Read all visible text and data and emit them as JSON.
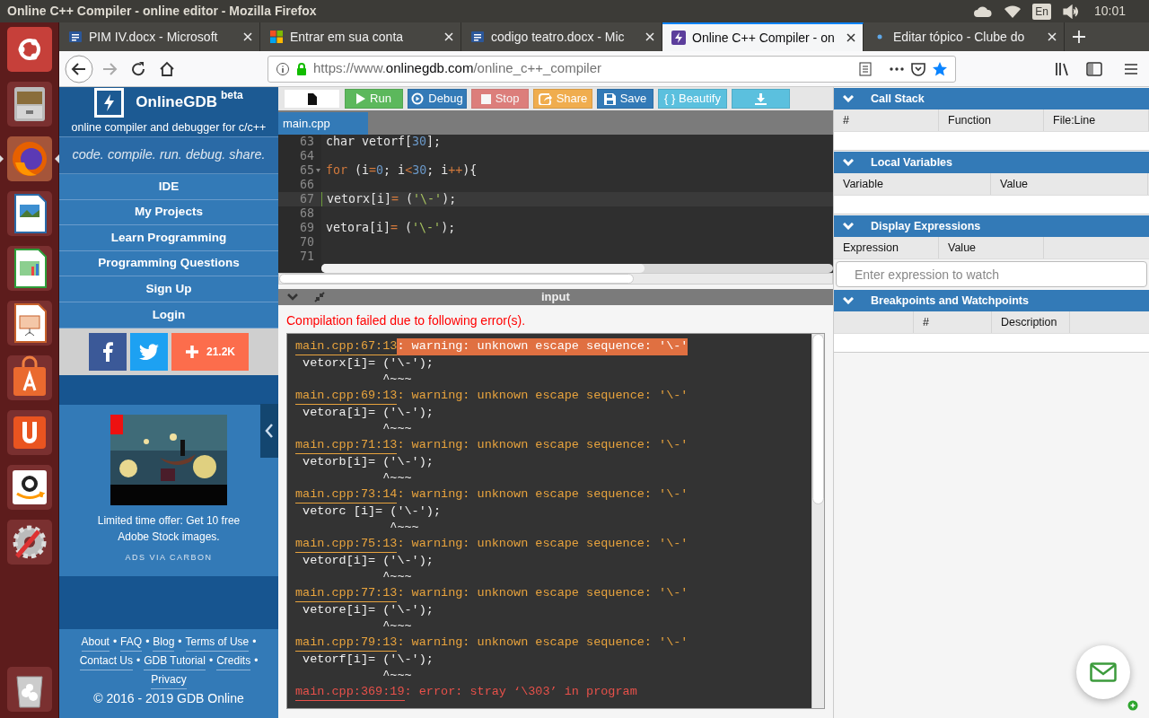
{
  "system_bar": {
    "window_title": "Online C++ Compiler - online editor - Mozilla Firefox",
    "keyboard_layout": "En",
    "clock": "10:01"
  },
  "launcher": {
    "items": [
      {
        "kind": "ubuntu",
        "running": false
      },
      {
        "kind": "files",
        "running": false
      },
      {
        "kind": "firefox",
        "running": true
      },
      {
        "kind": "draw",
        "running": false
      },
      {
        "kind": "calc",
        "running": false
      },
      {
        "kind": "impress",
        "running": false
      },
      {
        "kind": "store",
        "running": false
      },
      {
        "kind": "ubuntu-one",
        "running": false
      },
      {
        "kind": "amazon",
        "running": false
      },
      {
        "kind": "settings",
        "running": false
      },
      {
        "kind": "trash",
        "running": false
      }
    ]
  },
  "browser": {
    "tabs": [
      {
        "title": "PIM IV.docx - Microsoft",
        "kind": "word",
        "selected": false
      },
      {
        "title": "Entrar em sua conta",
        "kind": "microsoft",
        "selected": false
      },
      {
        "title": "codigo teatro.docx - Mic",
        "kind": "word",
        "selected": false
      },
      {
        "title": "Online C++ Compiler - on",
        "kind": "gdb",
        "selected": true
      },
      {
        "title": "Editar tópico - Clube do",
        "kind": "dot",
        "selected": false
      }
    ],
    "url": {
      "scheme": "https://www.",
      "domain": "onlinegdb.com",
      "path": "/online_c++_compiler"
    }
  },
  "sidebar": {
    "brand": "OnlineGDB",
    "badge": "beta",
    "tagline": "online compiler and debugger for c/c++",
    "motto": "code. compile. run. debug. share.",
    "nav": [
      "IDE",
      "My Projects",
      "Learn Programming",
      "Programming Questions",
      "Sign Up",
      "Login"
    ],
    "share_count": "21.2K",
    "ad": {
      "text": "Limited time offer: Get 10 free Adobe Stock images.",
      "via": "ADS VIA CARBON"
    },
    "footer_links": [
      "About",
      "FAQ",
      "Blog",
      "Terms of Use",
      "Contact Us",
      "GDB Tutorial",
      "Credits",
      "Privacy"
    ],
    "separator": "•",
    "copyright": "© 2016 - 2019 GDB Online"
  },
  "toolbar": [
    {
      "kind": "new-file",
      "disabled": false
    },
    {
      "kind": "run",
      "label": "Run",
      "disabled": false
    },
    {
      "kind": "debug",
      "label": "Debug",
      "disabled": false
    },
    {
      "kind": "stop",
      "label": "Stop",
      "disabled": true
    },
    {
      "kind": "share",
      "label": "Share",
      "disabled": false
    },
    {
      "kind": "save",
      "label": "Save",
      "disabled": false
    },
    {
      "kind": "beautify",
      "label": "{ } Beautify",
      "disabled": false
    },
    {
      "kind": "download",
      "disabled": false
    }
  ],
  "editor": {
    "file_tab": "main.cpp",
    "lines": [
      {
        "number": "63",
        "current": false,
        "foldable": false,
        "tokens": [
          {
            "kind": "plain",
            "text": "char vetorf["
          },
          {
            "kind": "number",
            "text": "30"
          },
          {
            "kind": "plain",
            "text": "];"
          }
        ]
      },
      {
        "number": "64",
        "current": false,
        "foldable": false
      },
      {
        "number": "65",
        "current": false,
        "foldable": true,
        "tokens": [
          {
            "kind": "keyword",
            "text": "for"
          },
          {
            "kind": "plain",
            "text": " (i"
          },
          {
            "kind": "operator",
            "text": "="
          },
          {
            "kind": "number",
            "text": "0"
          },
          {
            "kind": "plain",
            "text": "; i"
          },
          {
            "kind": "operator",
            "text": "<"
          },
          {
            "kind": "number",
            "text": "30"
          },
          {
            "kind": "plain",
            "text": "; i"
          },
          {
            "kind": "operator",
            "text": "++"
          },
          {
            "kind": "plain",
            "text": "){"
          }
        ]
      },
      {
        "number": "66",
        "current": false,
        "foldable": false
      },
      {
        "number": "67",
        "current": true,
        "foldable": false,
        "tokens": [
          {
            "kind": "plain",
            "text": "vetorx[i]"
          },
          {
            "kind": "operator",
            "text": "="
          },
          {
            "kind": "plain",
            "text": " ("
          },
          {
            "kind": "string",
            "text": "'\\-'"
          },
          {
            "kind": "plain",
            "text": ");"
          }
        ]
      },
      {
        "number": "68",
        "current": false,
        "foldable": false
      },
      {
        "number": "69",
        "current": false,
        "foldable": false,
        "tokens": [
          {
            "kind": "plain",
            "text": "vetora[i]"
          },
          {
            "kind": "operator",
            "text": "="
          },
          {
            "kind": "plain",
            "text": " ("
          },
          {
            "kind": "string",
            "text": "'\\-'"
          },
          {
            "kind": "plain",
            "text": ");"
          }
        ]
      },
      {
        "number": "70",
        "current": false,
        "foldable": false
      },
      {
        "number": "71",
        "current": false,
        "foldable": false
      }
    ]
  },
  "console_bar": {
    "title": "input"
  },
  "output": {
    "status": "Compilation failed due to following error(s).",
    "messages": [
      {
        "kind": "warning",
        "selected": true,
        "location": "main.cpp:67:13",
        "text": ": warning: unknown escape sequence: '\\-'",
        "source": " vetorx[i]= ('\\-');",
        "caret": "            ^~~~"
      },
      {
        "kind": "warning",
        "selected": false,
        "location": "main.cpp:69:13",
        "text": ": warning: unknown escape sequence: '\\-'",
        "source": " vetora[i]= ('\\-');",
        "caret": "            ^~~~"
      },
      {
        "kind": "warning",
        "selected": false,
        "location": "main.cpp:71:13",
        "text": ": warning: unknown escape sequence: '\\-'",
        "source": " vetorb[i]= ('\\-');",
        "caret": "            ^~~~"
      },
      {
        "kind": "warning",
        "selected": false,
        "location": "main.cpp:73:14",
        "text": ": warning: unknown escape sequence: '\\-'",
        "source": " vetorc [i]= ('\\-');",
        "caret": "             ^~~~"
      },
      {
        "kind": "warning",
        "selected": false,
        "location": "main.cpp:75:13",
        "text": ": warning: unknown escape sequence: '\\-'",
        "source": " vetord[i]= ('\\-');",
        "caret": "            ^~~~"
      },
      {
        "kind": "warning",
        "selected": false,
        "location": "main.cpp:77:13",
        "text": ": warning: unknown escape sequence: '\\-'",
        "source": " vetore[i]= ('\\-');",
        "caret": "            ^~~~"
      },
      {
        "kind": "warning",
        "selected": false,
        "location": "main.cpp:79:13",
        "text": ": warning: unknown escape sequence: '\\-'",
        "source": " vetorf[i]= ('\\-');",
        "caret": "            ^~~~"
      },
      {
        "kind": "error",
        "selected": false,
        "location": "main.cpp:369:19",
        "text": ": error: stray ‘\\303’ in program"
      }
    ]
  },
  "debugger": {
    "panels": [
      {
        "title": "Call Stack",
        "expanded": true,
        "columns": [
          "#",
          "Function",
          "File:Line"
        ]
      },
      {
        "title": "Local Variables",
        "expanded": true,
        "columns": [
          "Variable",
          "Value"
        ]
      },
      {
        "title": "Display Expressions",
        "expanded": true,
        "columns": [
          "Expression",
          "Value"
        ],
        "placeholder": "Enter expression to watch"
      },
      {
        "title": "Breakpoints and Watchpoints",
        "expanded": true,
        "leading_blank": true,
        "columns": [
          "#",
          "Description"
        ]
      }
    ]
  }
}
